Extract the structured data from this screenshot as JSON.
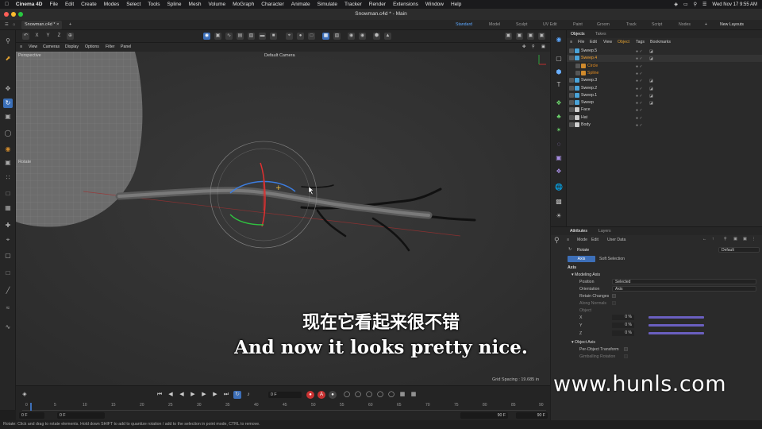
{
  "menubar": {
    "app": "Cinema 4D",
    "items": [
      "File",
      "Edit",
      "Create",
      "Modes",
      "Select",
      "Tools",
      "Spline",
      "Mesh",
      "Volume",
      "MoGraph",
      "Character",
      "Animate",
      "Simulate",
      "Tracker",
      "Render",
      "Extensions",
      "Window",
      "Help"
    ],
    "clock": "Wed Nov 17  9:55 AM"
  },
  "window": {
    "title": "Snowman.c4d * - Main",
    "doc_tab": "Snowman.c4d *",
    "layouts": [
      "Standard",
      "Model",
      "Sculpt",
      "UV Edit",
      "Paint",
      "Groom",
      "Track",
      "Script",
      "Nodes"
    ],
    "new_layouts": "New Layouts"
  },
  "toolbar": {
    "axis_x": "X",
    "axis_y": "Y",
    "axis_z": "Z"
  },
  "viewport": {
    "menu": [
      "View",
      "Cameras",
      "Display",
      "Options",
      "Filter",
      "Panel"
    ],
    "view_name": "Perspective",
    "camera": "Default Camera",
    "tool_label": "Rotate",
    "grid_spacing": "Grid Spacing : 19.685 in"
  },
  "subtitles": {
    "cn": "现在它看起来很不错",
    "en": "And now it looks pretty nice."
  },
  "watermark": "www.hunls.com",
  "timeline": {
    "current_frame": "0 F",
    "start_field": "0 F",
    "start_field2": "0 F",
    "end_field": "90 F",
    "end_field2": "90 F",
    "ruler": [
      "0",
      "5",
      "10",
      "15",
      "20",
      "25",
      "30",
      "35",
      "40",
      "45",
      "50",
      "55",
      "60",
      "65",
      "70",
      "75",
      "80",
      "85",
      "90"
    ]
  },
  "status": "Rotate: Click and drag to rotate elements. Hold down SHIFT to add to quantize rotation / add to the selection in point mode, CTRL to remove.",
  "objects": {
    "tabs": [
      "Objects",
      "Takes"
    ],
    "menu": [
      "File",
      "Edit",
      "View",
      "Object",
      "Tags",
      "Bookmarks"
    ],
    "rows": [
      {
        "name": "Sweep.5",
        "indent": 0,
        "state": "normal",
        "color": "#4aa3d8"
      },
      {
        "name": "Sweep.4",
        "indent": 0,
        "state": "selected",
        "color": "#4aa3d8"
      },
      {
        "name": "Circle",
        "indent": 1,
        "state": "child",
        "color": "#d08a2c"
      },
      {
        "name": "Spline",
        "indent": 1,
        "state": "child",
        "color": "#d08a2c"
      },
      {
        "name": "Sweep.3",
        "indent": 0,
        "state": "normal",
        "color": "#4aa3d8"
      },
      {
        "name": "Sweep.2",
        "indent": 0,
        "state": "normal",
        "color": "#4aa3d8"
      },
      {
        "name": "Sweep.1",
        "indent": 0,
        "state": "normal",
        "color": "#4aa3d8"
      },
      {
        "name": "Sweep",
        "indent": 0,
        "state": "normal",
        "color": "#4aa3d8"
      },
      {
        "name": "Face",
        "indent": 0,
        "state": "normal",
        "color": "#cfcfcf"
      },
      {
        "name": "Hat",
        "indent": 0,
        "state": "normal",
        "color": "#cfcfcf"
      },
      {
        "name": "Body",
        "indent": 0,
        "state": "normal",
        "color": "#cfcfcf"
      }
    ]
  },
  "attributes": {
    "tabs": [
      "Attributes",
      "Layers"
    ],
    "menu": [
      "Mode",
      "Edit",
      "User Data"
    ],
    "tool": "Rotate",
    "preset": "Default",
    "subtabs": [
      "Axis",
      "Soft Selection"
    ],
    "section": "Axis",
    "group1": "Modeling Axis",
    "position_label": "Position",
    "position_value": "Selected",
    "orientation_label": "Orientation",
    "orientation_value": "Axis",
    "retain_changes": "Retain Changes",
    "along_normals": "Along Normals",
    "object_label": "Object",
    "x_label": "X",
    "y_label": "Y",
    "z_label": "Z",
    "x_value": "0 %",
    "y_value": "0 %",
    "z_value": "0 %",
    "group2": "Object Axis",
    "per_object": "Per-Object Transform",
    "gimballing": "Gimballing Rotation"
  }
}
